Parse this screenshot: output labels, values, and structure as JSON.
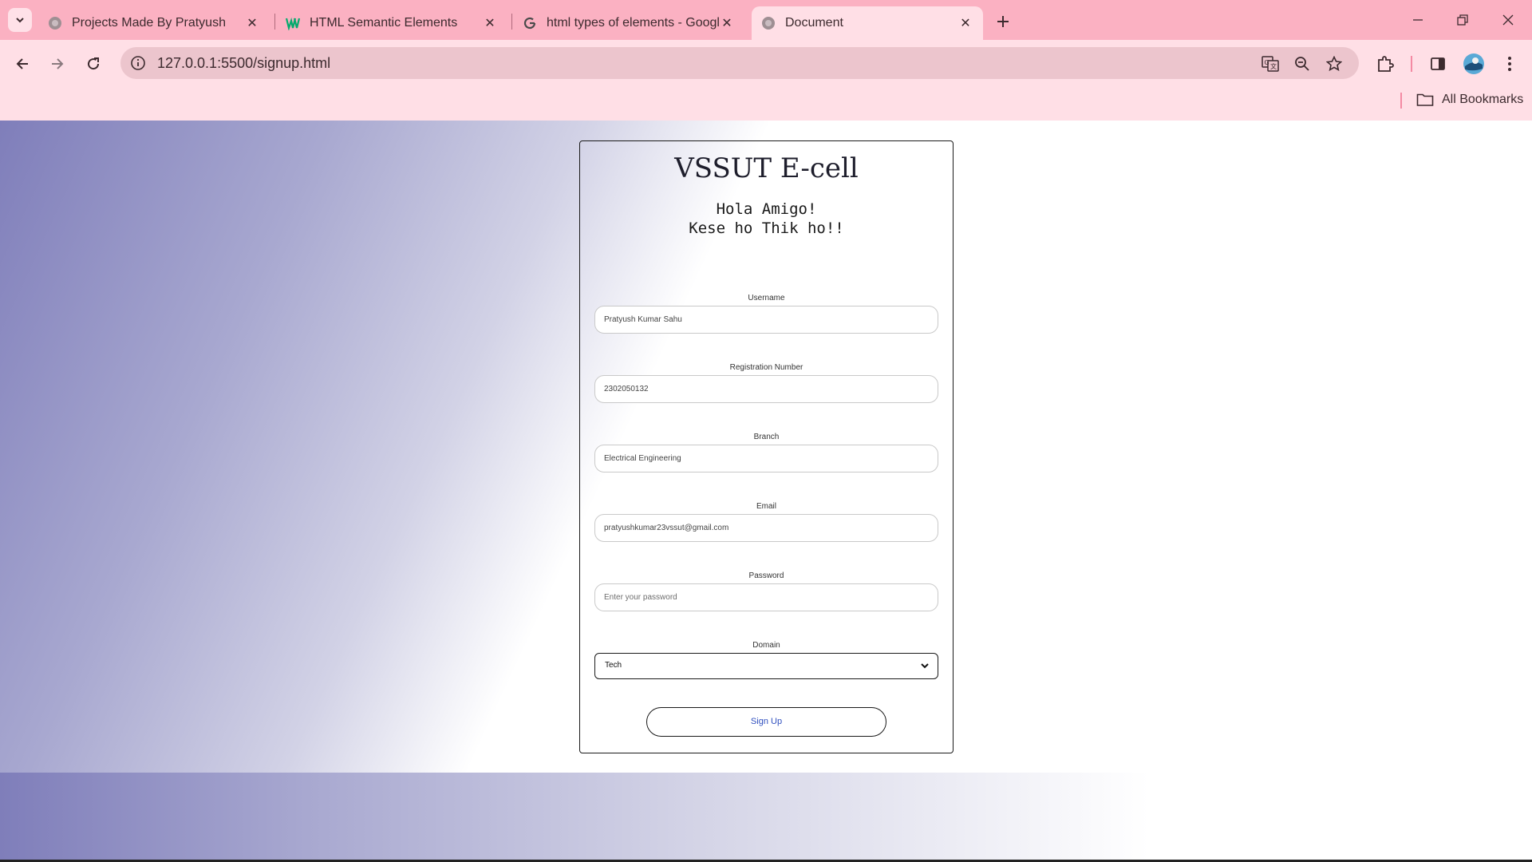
{
  "tabs": [
    {
      "title": "Projects Made By Pratyush",
      "icon": "globe-icon"
    },
    {
      "title": "HTML Semantic Elements",
      "icon": "w3schools-icon"
    },
    {
      "title": "html types of elements - Googl",
      "icon": "google-icon"
    },
    {
      "title": "Document",
      "icon": "globe-icon"
    }
  ],
  "address_bar": {
    "url": "127.0.0.1:5500/signup.html"
  },
  "bookmarks": {
    "all_label": "All Bookmarks"
  },
  "form": {
    "title": "VSSUT E-cell",
    "greeting_line1": "Hola Amigo!",
    "greeting_line2": "Kese ho Thik ho!!",
    "fields": [
      {
        "label": "Username",
        "value": "Pratyush Kumar Sahu"
      },
      {
        "label": "Registration Number",
        "value": "2302050132"
      },
      {
        "label": "Branch",
        "value": "Electrical Engineering"
      },
      {
        "label": "Email",
        "value": "pratyushkumar23vssut@gmail.com"
      },
      {
        "label": "Password",
        "placeholder": "Enter your password"
      },
      {
        "label": "Domain",
        "selected": "Tech"
      }
    ],
    "submit_label": "Sign Up"
  },
  "colors": {
    "tab_strip": "#fbb1c2",
    "toolbar": "#ffdfe6",
    "omnibox": "#ecc5cd",
    "gradient_start": "#7f7eba",
    "link": "#2f4fbf"
  }
}
